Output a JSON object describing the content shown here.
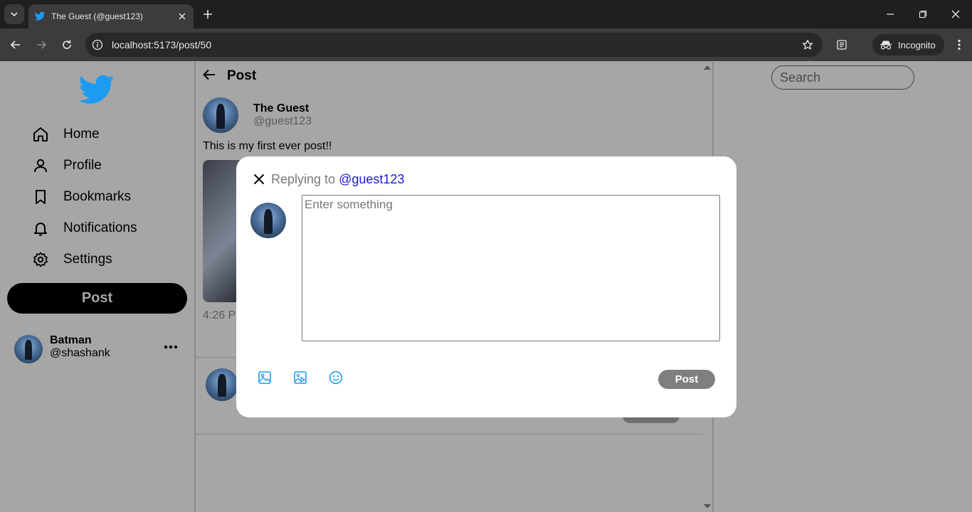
{
  "browser": {
    "tab_title": "The Guest (@guest123)",
    "url": "localhost:5173/post/50",
    "incognito_label": "Incognito"
  },
  "sidebar": {
    "items": [
      {
        "label": "Home",
        "icon": "home-icon"
      },
      {
        "label": "Profile",
        "icon": "user-icon"
      },
      {
        "label": "Bookmarks",
        "icon": "bookmark-icon"
      },
      {
        "label": "Notifications",
        "icon": "bell-icon"
      },
      {
        "label": "Settings",
        "icon": "gear-icon"
      }
    ],
    "post_button": "Post",
    "user": {
      "name": "Batman",
      "handle": "@shashank"
    }
  },
  "main": {
    "header_title": "Post",
    "author": {
      "name": "The Guest",
      "handle": "@guest123"
    },
    "text": "This is my first ever post!!",
    "time": "4:26 P"
  },
  "search": {
    "placeholder": "Search"
  },
  "modal": {
    "replying_prefix": "Replying to",
    "replying_handle": "@guest123",
    "placeholder": "Enter something",
    "post_button": "Post"
  },
  "colors": {
    "accent": "#1d9bf0",
    "overlay": "#a6a6a6",
    "link": "#1a1ad6"
  }
}
